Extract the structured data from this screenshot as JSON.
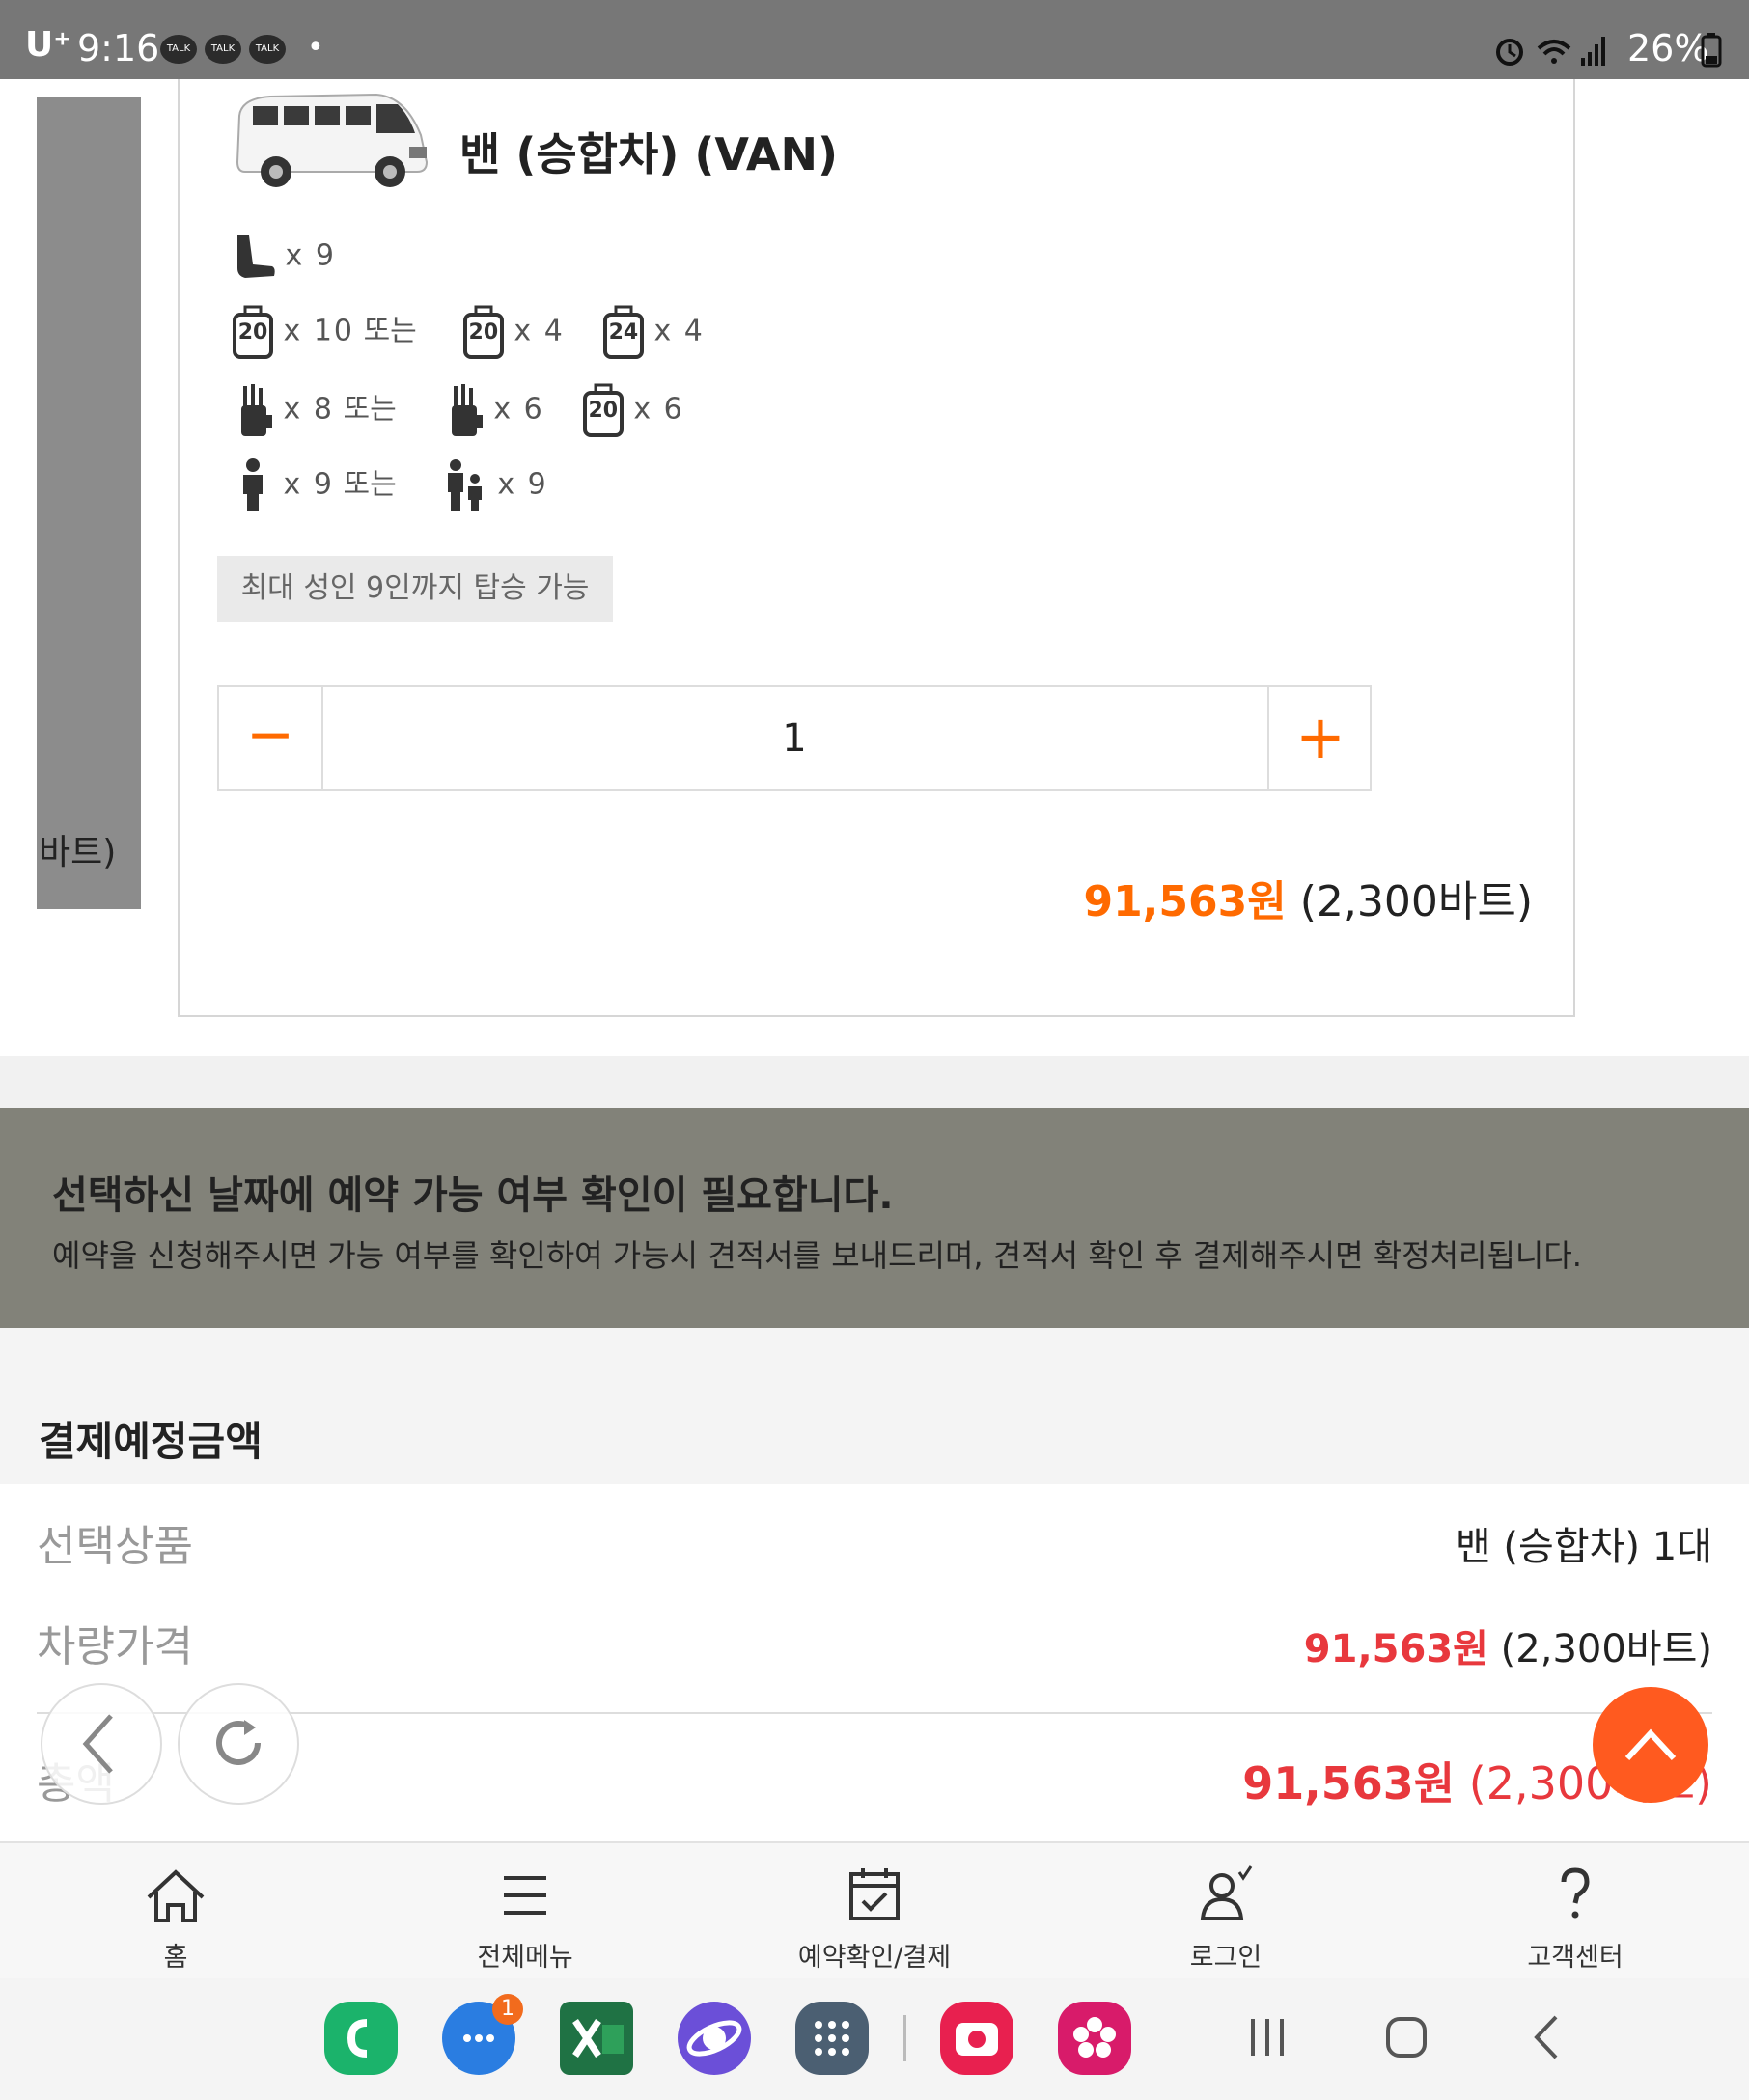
{
  "status_bar": {
    "carrier": "U⁺",
    "time": "9:16",
    "talk_badge": "TALK",
    "battery": "26%"
  },
  "side_card": {
    "label": "바트)"
  },
  "vehicle": {
    "title": "밴 (승합차) (VAN)",
    "seats": "x 9",
    "luggage": {
      "opt1": "x 10",
      "or": "또는",
      "opt2": "x 4",
      "opt3": "x 4",
      "size20": "20",
      "size24": "24"
    },
    "golf": {
      "opt1": "x 8",
      "or": "또는",
      "opt2": "x 6",
      "opt3": "x 6",
      "size20": "20"
    },
    "people": {
      "opt1": "x 9",
      "or": "또는",
      "opt2": "x 9"
    },
    "capacity_note": "최대 성인 9인까지 탑승 가능",
    "quantity": "1",
    "price_krw": "91,563원",
    "price_thb": "(2,300바트)"
  },
  "notice": {
    "title": "선택하신 날짜에 예약 가능 여부 확인이 필요합니다.",
    "description": "예약을 신청해주시면 가능 여부를 확인하여 가능시 견적서를 보내드리며, 견적서 확인 후 결제해주시면 확정처리됩니다."
  },
  "payment": {
    "heading": "결제예정금액",
    "rows": [
      {
        "label": "선택상품",
        "value": "밴 (승합차) 1대"
      },
      {
        "label": "차량가격",
        "value_krw": "91,563원",
        "value_thb": "(2,300바트)"
      },
      {
        "label": "총액",
        "value_krw": "91,563원",
        "value_thb": "(2,300바트)"
      }
    ]
  },
  "bottom_nav": [
    {
      "label": "홈",
      "icon": "home-icon"
    },
    {
      "label": "전체메뉴",
      "icon": "menu-icon"
    },
    {
      "label": "예약확인/결제",
      "icon": "calendar-check-icon"
    },
    {
      "label": "로그인",
      "icon": "user-login-icon"
    },
    {
      "label": "고객센터",
      "icon": "help-icon"
    }
  ],
  "dock": {
    "messages_badge": "1"
  },
  "colors": {
    "accent_orange": "#ff6a00",
    "price_red": "#e8383d",
    "notice_bg": "#828279",
    "top_button": "#ff5a1f"
  }
}
